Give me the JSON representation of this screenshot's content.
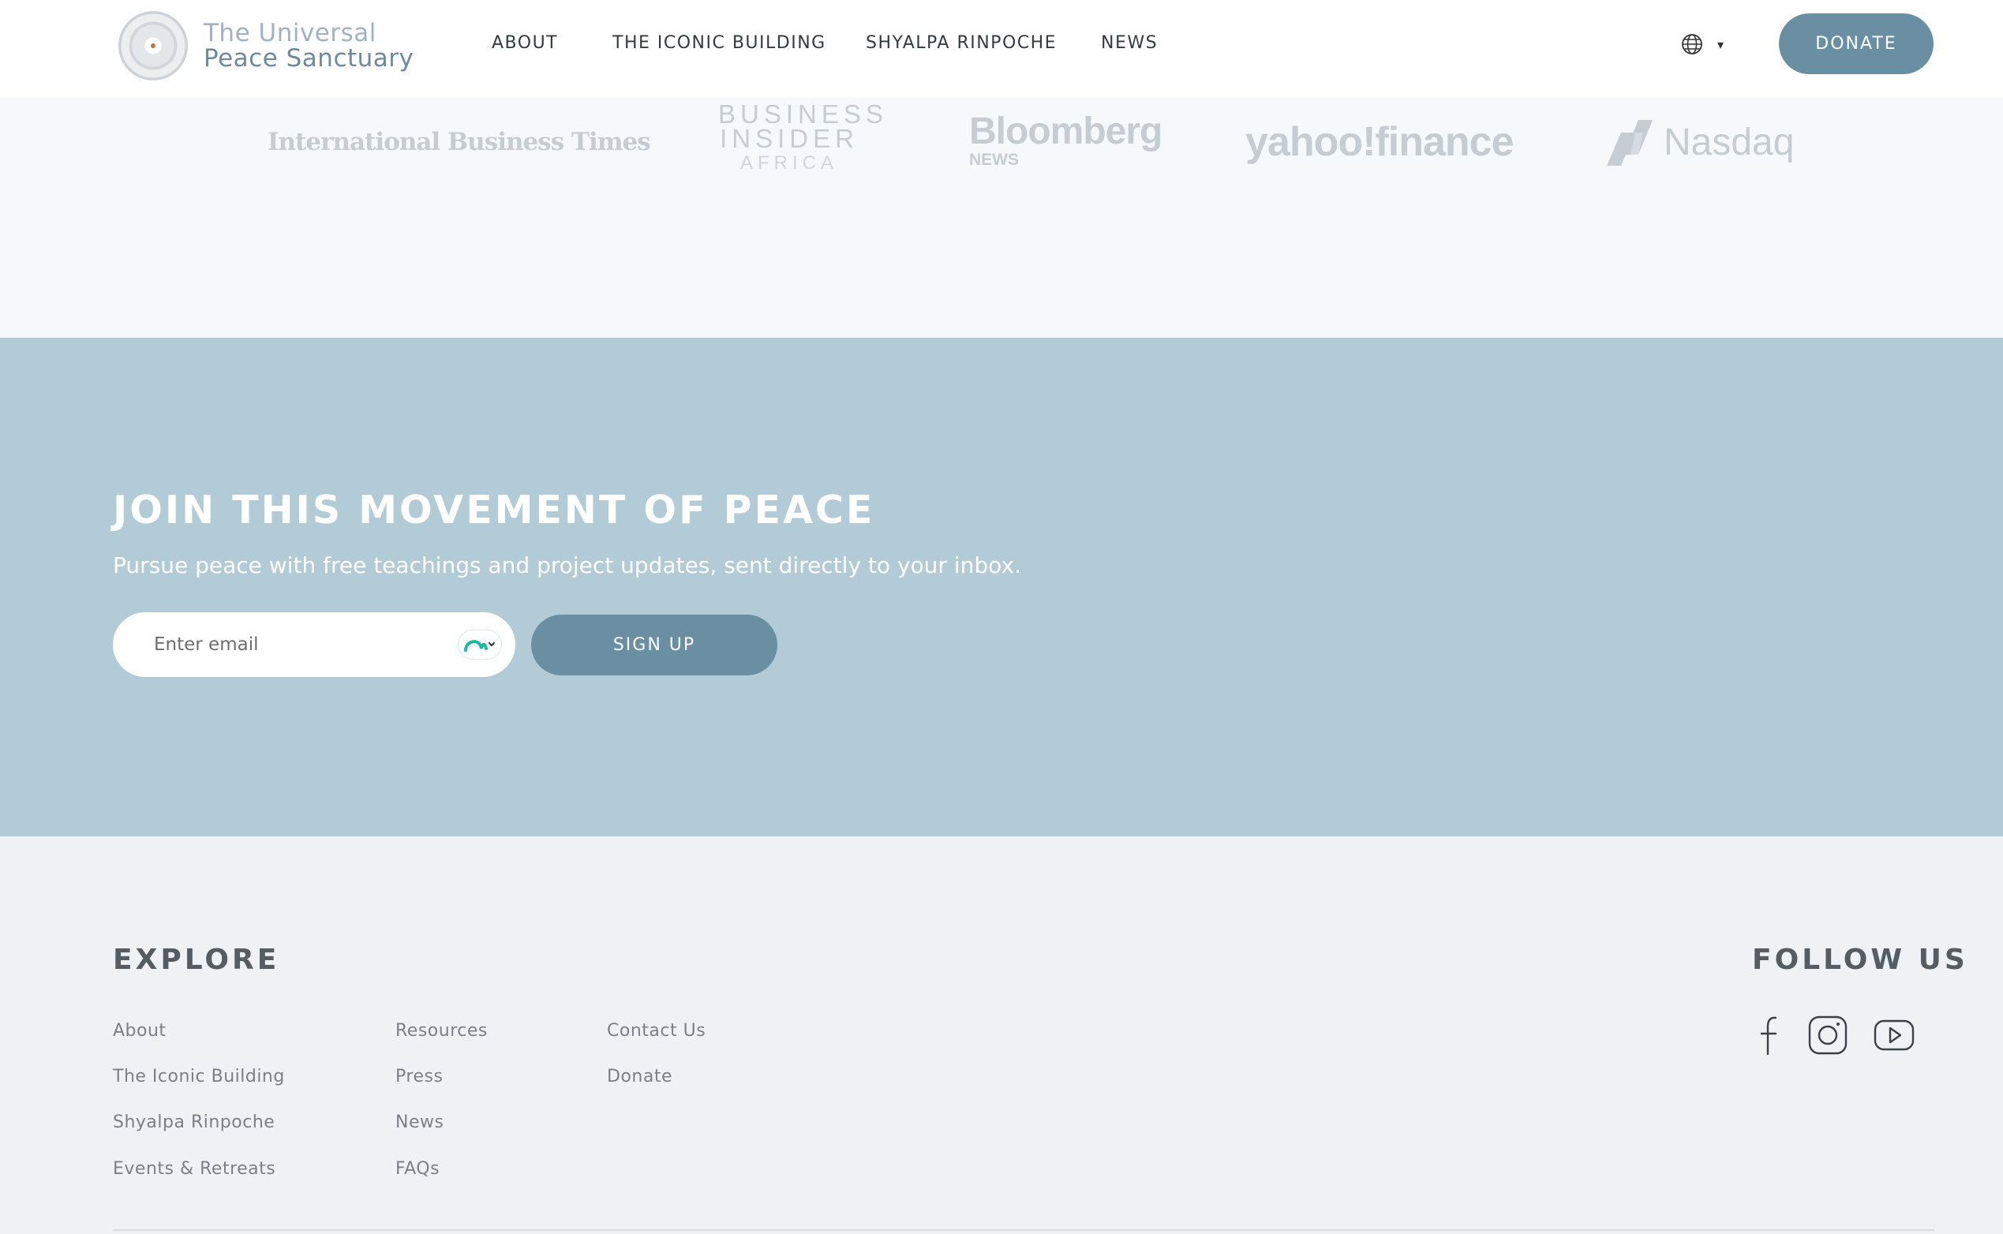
{
  "header": {
    "logo": {
      "line1": "The Universal",
      "line2": "Peace Sanctuary"
    },
    "nav": [
      "ABOUT",
      "THE ICONIC BUILDING",
      "SHYALPA RINPOCHE",
      "NEWS"
    ],
    "language_icon": "globe-icon",
    "language_caret": "▾",
    "donate_label": "DONATE"
  },
  "press": {
    "ibt": "International Business Times",
    "business_insider": {
      "line1": "BUSINESS",
      "line2": "INSIDER",
      "line3": "AFRICA"
    },
    "bloomberg": {
      "line1": "Bloomberg",
      "line2": "NEWS"
    },
    "yahoo": "yahoo!finance",
    "nasdaq": "Nasdaq"
  },
  "newsletter": {
    "title": "JOIN THIS MOVEMENT OF PEACE",
    "subtitle": "Pursue peace with free teachings and project updates, sent directly to your inbox.",
    "email_placeholder": "Enter email",
    "email_value": "",
    "signup_label": "SIGN UP"
  },
  "footer": {
    "explore_heading": "EXPLORE",
    "col1": [
      "About",
      "The Iconic Building",
      "Shyalpa Rinpoche",
      "Events & Retreats"
    ],
    "col2": [
      "Resources",
      "Press",
      "News",
      "FAQs"
    ],
    "col3": [
      "Contact Us",
      "Donate"
    ],
    "follow_heading": "FOLLOW US",
    "social": [
      "facebook-icon",
      "instagram-icon",
      "youtube-icon"
    ]
  },
  "colors": {
    "accent": "#6a8fa3",
    "band": "#b3cbd6",
    "footer_bg": "#eef2f5",
    "press_bg": "#f6f9fb"
  }
}
